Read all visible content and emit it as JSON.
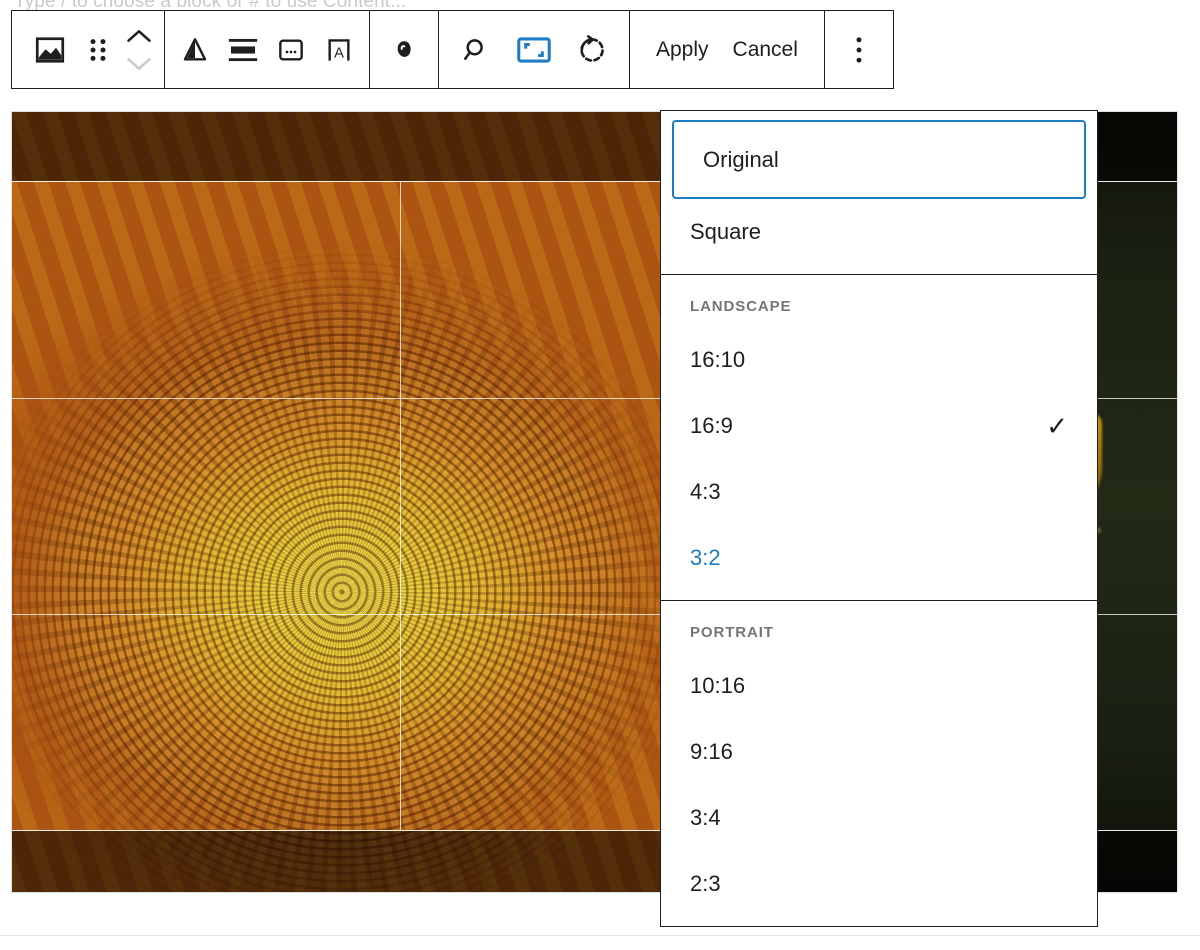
{
  "editor": {
    "placeholder_text": "Type / to choose a block or # to use Content..."
  },
  "toolbar": {
    "block_type_icon": "image-icon",
    "drag_handle_icon": "drag-handle-icon",
    "move_up_icon": "chevron-up-icon",
    "move_down_icon": "chevron-down-icon",
    "align_icon": "align-icon",
    "full_width_icon": "full-width-icon",
    "caption_icon": "caption-icon",
    "text_over_image_icon": "text-over-image-icon",
    "link_icon": "link-icon",
    "zoom_icon": "zoom-icon",
    "crop_icon": "crop-icon",
    "rotate_icon": "rotate-icon",
    "apply_label": "Apply",
    "cancel_label": "Cancel",
    "more_options_icon": "more-options-icon",
    "accent_color": "#1d7dc4"
  },
  "aspect_menu": {
    "sections": [
      {
        "label": "",
        "items": [
          {
            "label": "Original",
            "checked": false,
            "state": "focused"
          },
          {
            "label": "Square",
            "checked": false,
            "state": "normal"
          }
        ]
      },
      {
        "label": "Landscape",
        "items": [
          {
            "label": "16:10",
            "checked": false,
            "state": "normal"
          },
          {
            "label": "16:9",
            "checked": true,
            "state": "normal"
          },
          {
            "label": "4:3",
            "checked": false,
            "state": "normal"
          },
          {
            "label": "3:2",
            "checked": false,
            "state": "hovered"
          }
        ]
      },
      {
        "label": "Portrait",
        "items": [
          {
            "label": "10:16",
            "checked": false,
            "state": "normal"
          },
          {
            "label": "9:16",
            "checked": false,
            "state": "normal"
          },
          {
            "label": "3:4",
            "checked": false,
            "state": "normal"
          },
          {
            "label": "2:3",
            "checked": false,
            "state": "normal"
          }
        ]
      }
    ],
    "check_glyph": "✓",
    "selected_ratio": "16:9",
    "hover_color": "#1d7dc4",
    "section_label_color": "#757575"
  },
  "cropper": {
    "image_alt": "Close-up photograph of a sunflower head",
    "grid": "rule-of-thirds",
    "overlay_opacity": "0.55"
  }
}
